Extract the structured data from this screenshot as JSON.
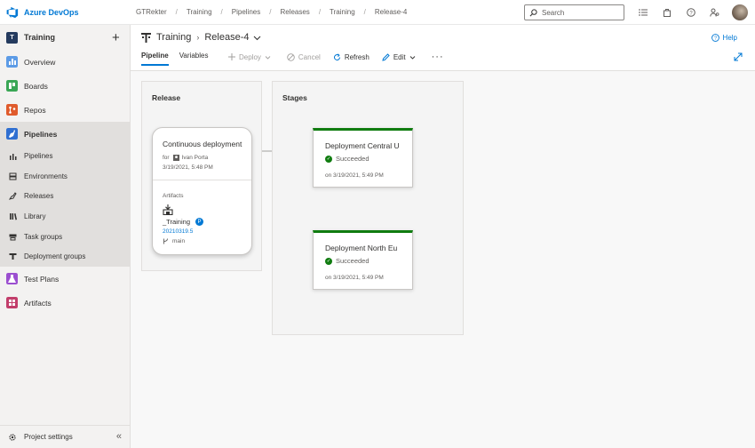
{
  "topbar": {
    "brand": "Azure DevOps",
    "breadcrumbs": [
      "GTRekter",
      "Training",
      "Pipelines",
      "Releases",
      "Training",
      "Release-4"
    ],
    "search_placeholder": "Search"
  },
  "sidebar": {
    "project_initial": "T",
    "project_name": "Training",
    "items": [
      {
        "label": "Overview",
        "color": "#5c9be6"
      },
      {
        "label": "Boards",
        "color": "#3aa655"
      },
      {
        "label": "Repos",
        "color": "#e05b2c"
      },
      {
        "label": "Pipelines",
        "color": "#2f6fd1"
      }
    ],
    "sub_items": [
      {
        "label": "Pipelines"
      },
      {
        "label": "Environments"
      },
      {
        "label": "Releases"
      },
      {
        "label": "Library"
      },
      {
        "label": "Task groups"
      },
      {
        "label": "Deployment groups"
      }
    ],
    "bottom_items": [
      {
        "label": "Test Plans",
        "color": "#9b4fd0"
      },
      {
        "label": "Artifacts",
        "color": "#c23e6b"
      }
    ],
    "footer": "Project settings"
  },
  "header": {
    "pipeline_name": "Training",
    "release_name": "Release-4",
    "help": "Help",
    "tabs": [
      "Pipeline",
      "Variables"
    ],
    "toolbar": {
      "deploy": "Deploy",
      "cancel": "Cancel",
      "refresh": "Refresh",
      "edit": "Edit"
    }
  },
  "release_panel": {
    "title": "Release",
    "card": {
      "title": "Continuous deployment",
      "for_label": "for",
      "user": "Ivan Porta",
      "timestamp": "3/19/2021, 5:48 PM",
      "artifacts_label": "Artifacts",
      "artifact_name": "_Training",
      "artifact_badge": "P",
      "artifact_version": "20210319.5",
      "artifact_branch": "main"
    }
  },
  "stages_panel": {
    "title": "Stages",
    "stages": [
      {
        "name": "Deployment Central U",
        "status": "Succeeded",
        "date": "on 3/19/2021, 5:49 PM"
      },
      {
        "name": "Deployment North Eu",
        "status": "Succeeded",
        "date": "on 3/19/2021, 5:49 PM"
      }
    ]
  },
  "colors": {
    "accent": "#0078d4",
    "success": "#107c10"
  }
}
